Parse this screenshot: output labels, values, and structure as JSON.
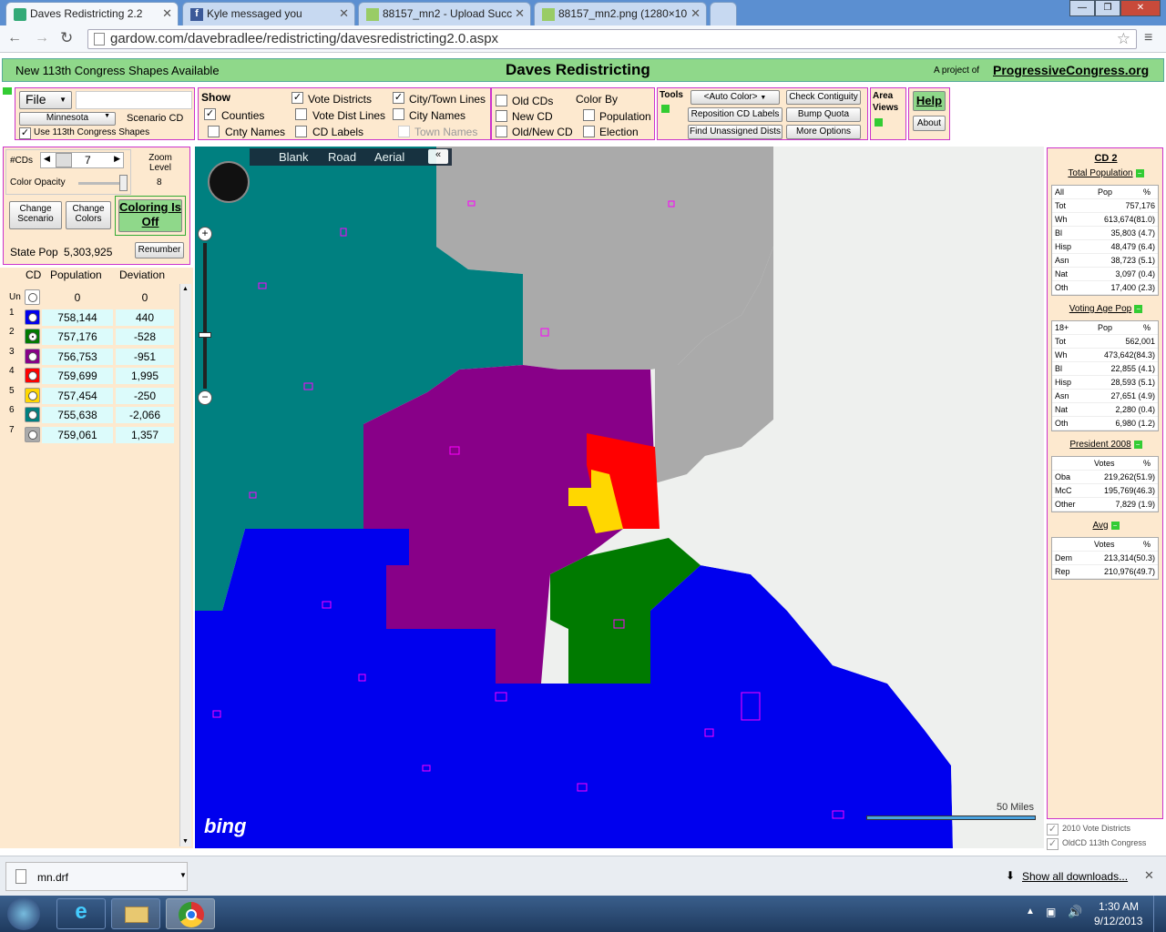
{
  "tabs": [
    {
      "title": "Daves Redistricting 2.2",
      "active": true
    },
    {
      "title": "Kyle messaged you"
    },
    {
      "title": "88157_mn2 - Upload Succ"
    },
    {
      "title": "88157_mn2.png (1280×10"
    }
  ],
  "address": "gardow.com/davebradlee/redistricting/davesredistricting2.0.aspx",
  "header": {
    "notice": "New 113th Congress Shapes Available",
    "title": "Daves Redistricting",
    "project_prefix": "A project of",
    "project_link": "ProgressiveCongress.org"
  },
  "toolbar": {
    "file": "File",
    "state": "Minnesota",
    "scenario": "Scenario CD",
    "use_113": "Use 113th Congress Shapes",
    "show": "Show",
    "show_items": [
      "Counties",
      "Cnty Names",
      "Vote Districts",
      "Vote Dist Lines",
      "CD Labels",
      "City/Town Lines",
      "City Names",
      "Town Names"
    ],
    "cd_items": [
      "Old CDs",
      "New CD",
      "Old/New CD"
    ],
    "color_by": "Color By",
    "color_items": [
      "Population",
      "Election"
    ],
    "tools": "Tools",
    "auto_color": "<Auto Color>",
    "check_contiguity": "Check Contiguity",
    "reposition": "Reposition CD Labels",
    "bump_quota": "Bump Quota",
    "find_unassigned": "Find Unassigned Dists",
    "more_options": "More Options",
    "area_views": "Area Views",
    "help": "Help",
    "about": "About"
  },
  "left": {
    "cds_label": "#CDs",
    "cds_value": "7",
    "zoom_label": "Zoom Level",
    "zoom_value": "8",
    "opacity": "Color Opacity",
    "change_scenario": "Change Scenario",
    "change_colors": "Change Colors",
    "coloring": "Coloring Is Off",
    "state_pop_label": "State Pop",
    "state_pop": "5,303,925",
    "renumber": "Renumber",
    "col_cd": "CD",
    "col_pop": "Population",
    "col_dev": "Deviation",
    "rows": [
      {
        "n": "Un",
        "color": "#ffffff",
        "pop": "0",
        "dev": "0"
      },
      {
        "n": "1",
        "color": "#0000ee",
        "pop": "758,144",
        "dev": "440"
      },
      {
        "n": "2",
        "color": "#007a00",
        "pop": "757,176",
        "dev": "-528"
      },
      {
        "n": "3",
        "color": "#880088",
        "pop": "756,753",
        "dev": "-951"
      },
      {
        "n": "4",
        "color": "#ff0000",
        "pop": "759,699",
        "dev": "1,995"
      },
      {
        "n": "5",
        "color": "#ffd700",
        "pop": "757,454",
        "dev": "-250"
      },
      {
        "n": "6",
        "color": "#008080",
        "pop": "755,638",
        "dev": "-2,066"
      },
      {
        "n": "7",
        "color": "#aaaaaa",
        "pop": "759,061",
        "dev": "1,357"
      }
    ]
  },
  "map": {
    "buttons": [
      "Blank",
      "Road",
      "Aerial"
    ],
    "scale": "50 Miles",
    "brand": "bing"
  },
  "stats": {
    "title": "CD 2",
    "total_pop": "Total Population",
    "t1_hdr": [
      "All",
      "Pop",
      "%"
    ],
    "t1": [
      [
        "Tot",
        "757,176"
      ],
      [
        "Wh",
        "613,674(81.0)"
      ],
      [
        "Bl",
        "35,803 (4.7)"
      ],
      [
        "Hisp",
        "48,479 (6.4)"
      ],
      [
        "Asn",
        "38,723 (5.1)"
      ],
      [
        "Nat",
        "3,097 (0.4)"
      ],
      [
        "Oth",
        "17,400 (2.3)"
      ]
    ],
    "vap": "Voting Age Pop",
    "t2_hdr": [
      "18+",
      "Pop",
      "%"
    ],
    "t2": [
      [
        "Tot",
        "562,001"
      ],
      [
        "Wh",
        "473,642(84.3)"
      ],
      [
        "Bl",
        "22,855 (4.1)"
      ],
      [
        "Hisp",
        "28,593 (5.1)"
      ],
      [
        "Asn",
        "27,651 (4.9)"
      ],
      [
        "Nat",
        "2,280 (0.4)"
      ],
      [
        "Oth",
        "6,980 (1.2)"
      ]
    ],
    "pres": "President 2008",
    "t3_hdr": [
      "Votes",
      "%"
    ],
    "t3": [
      [
        "Oba",
        "219,262(51.9)"
      ],
      [
        "McC",
        "195,769(46.3)"
      ],
      [
        "Other",
        "7,829 (1.9)"
      ]
    ],
    "avg": "Avg",
    "t4_hdr": [
      "Votes",
      "%"
    ],
    "t4": [
      [
        "Dem",
        "213,314(50.3)"
      ],
      [
        "Rep",
        "210,976(49.7)"
      ]
    ],
    "legend1": "2010 Vote Districts",
    "legend2": "OldCD 113th Congress"
  },
  "downloads": {
    "file": "mn.drf",
    "show_all": "Show all downloads..."
  },
  "clock": {
    "time": "1:30 AM",
    "date": "9/12/2013"
  }
}
